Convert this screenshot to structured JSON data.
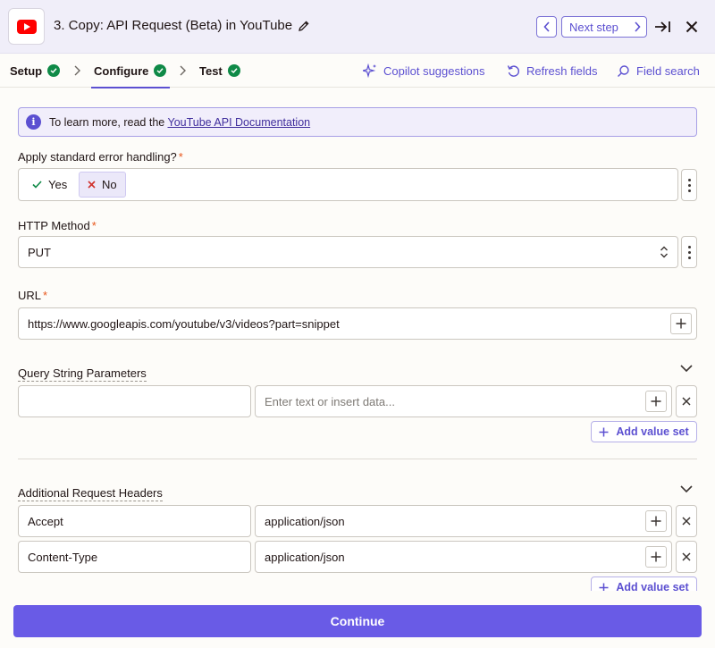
{
  "header": {
    "title": "3. Copy: API Request (Beta) in YouTube",
    "next_label": "Next step"
  },
  "tabs": [
    {
      "label": "Setup"
    },
    {
      "label": "Configure"
    },
    {
      "label": "Test"
    }
  ],
  "tools": {
    "copilot": "Copilot suggestions",
    "refresh": "Refresh fields",
    "search": "Field search"
  },
  "info": {
    "text": "To learn more, read the",
    "link": "YouTube API Documentation"
  },
  "error_handling": {
    "label": "Apply standard error handling?",
    "required": "*",
    "options": [
      "Yes",
      "No"
    ],
    "selected": "No"
  },
  "http_method": {
    "label": "HTTP Method",
    "required": "*",
    "value": "PUT"
  },
  "url": {
    "label": "URL",
    "required": "*",
    "value": "https://www.googleapis.com/youtube/v3/videos?part=snippet"
  },
  "query_params": {
    "label": "Query String Parameters",
    "rows": [
      {
        "key": "",
        "value_placeholder": "Enter text or insert data..."
      }
    ],
    "add_label": "Add value set"
  },
  "headers": {
    "label": "Additional Request Headers",
    "rows": [
      {
        "key": "Accept",
        "value": "application/json"
      },
      {
        "key": "Content-Type",
        "value": "application/json"
      }
    ],
    "add_label": "Add value set"
  },
  "footer": {
    "continue_label": "Continue"
  }
}
